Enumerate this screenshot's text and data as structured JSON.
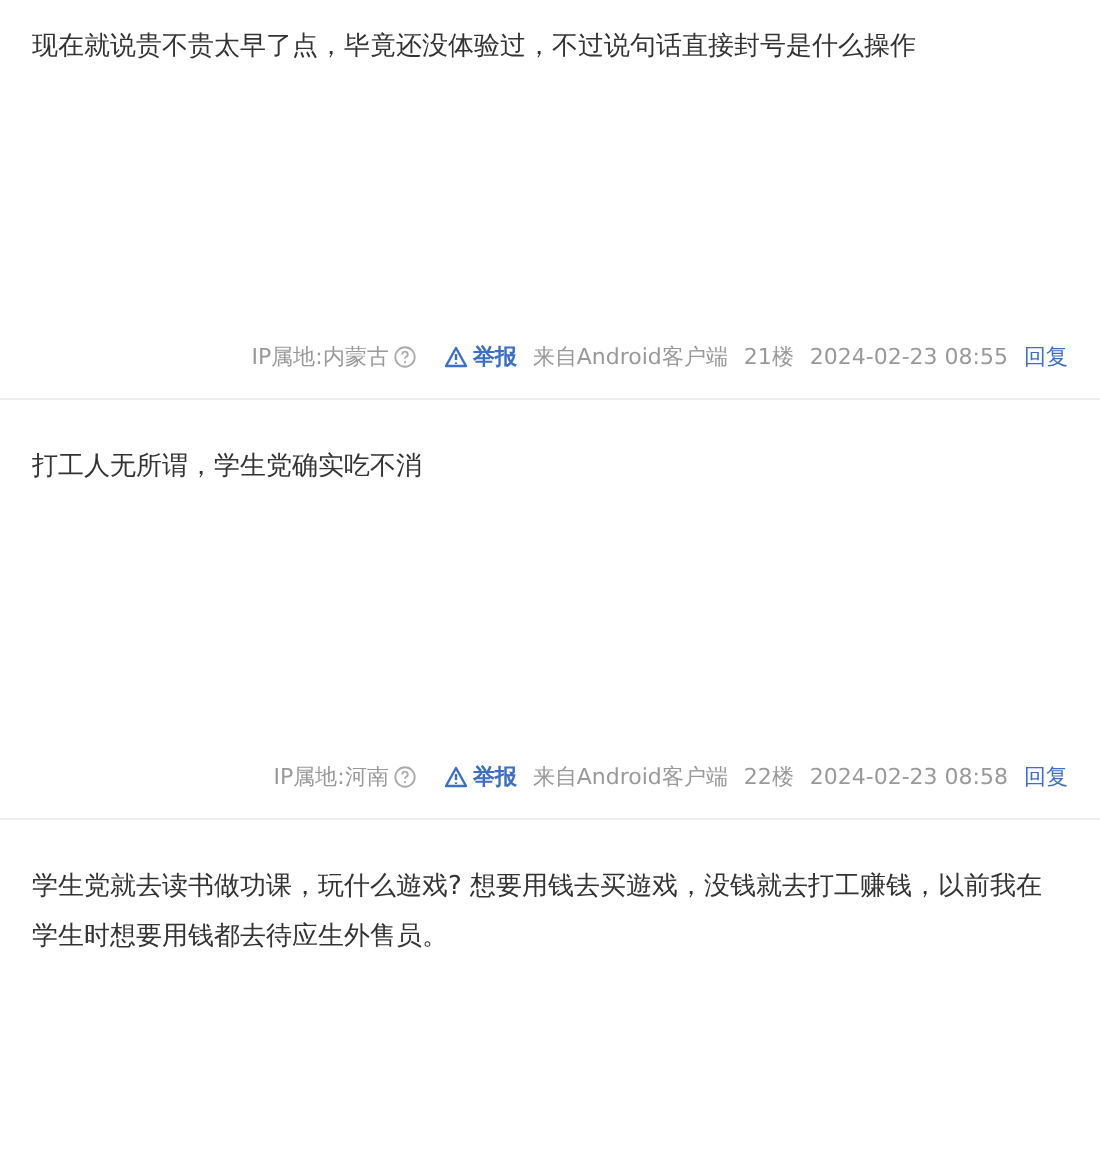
{
  "posts": [
    {
      "content": "现在就说贵不贵太早了点，毕竟还没体验过，不过说句话直接封号是什么操作",
      "ip": "IP属地:内蒙古",
      "report": "举报",
      "source": "来自Android客户端",
      "floor": "21楼",
      "time": "2024-02-23 08:55",
      "reply": "回复"
    },
    {
      "content": "打工人无所谓，学生党确实吃不消",
      "ip": "IP属地:河南",
      "report": "举报",
      "source": "来自Android客户端",
      "floor": "22楼",
      "time": "2024-02-23 08:58",
      "reply": "回复"
    },
    {
      "content": "学生党就去读书做功课，玩什么遊戏? 想要用钱去买遊戏，没钱就去打工赚钱，以前我在学生时想要用钱都去待应生外售员。"
    }
  ]
}
